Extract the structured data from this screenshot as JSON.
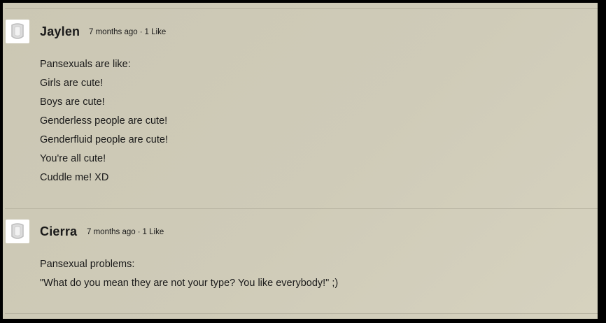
{
  "comments": [
    {
      "author": "Jaylen",
      "time": "7 months ago",
      "separator": "·",
      "likes": "1 Like",
      "lines": [
        "Pansexuals are like:",
        "Girls are cute!",
        "Boys are cute!",
        "Genderless people are cute!",
        "Genderfluid people are cute!",
        "You're all cute!",
        "Cuddle me! XD"
      ]
    },
    {
      "author": "Cierra",
      "time": "7 months ago",
      "separator": "·",
      "likes": "1 Like",
      "lines": [
        "Pansexual problems:",
        "\"What do you mean they are not your type? You like everybody!\" ;)"
      ]
    }
  ]
}
